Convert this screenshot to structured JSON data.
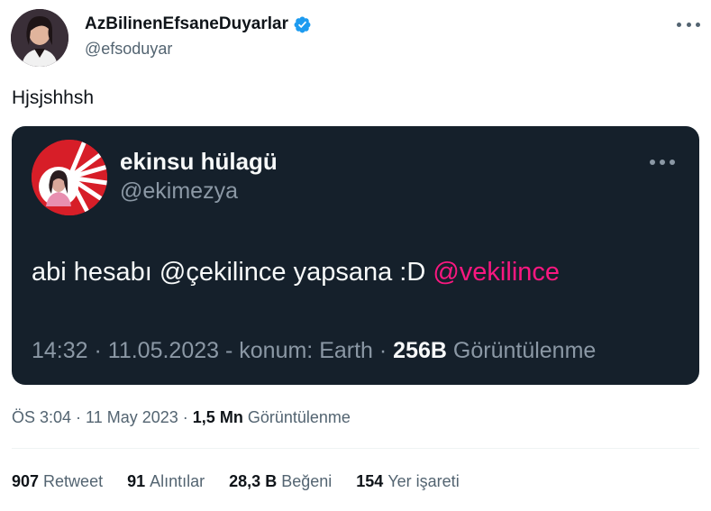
{
  "author": {
    "display_name": "AzBilinenEfsaneDuyarlar",
    "handle": "@efsoduyar",
    "verified_icon": "verified-badge-icon"
  },
  "tweet": {
    "text": "Hjsjshhsh"
  },
  "quoted": {
    "display_name": "ekinsu hülagü",
    "handle": "@ekimezya",
    "text_prefix": "abi hesabı @çekilince yapsana :D",
    "text_mention": "@vekilince",
    "meta_time": "14:32 · 11.05.2023 - konum: Earth ·",
    "meta_views_count": "256B",
    "meta_views_label": "Görüntülenme"
  },
  "meta": {
    "time_date": "ÖS 3:04 · 11 May 2023 ·",
    "views_count": "1,5 Mn",
    "views_label": "Görüntülenme"
  },
  "stats": [
    {
      "count": "907",
      "label": "Retweet"
    },
    {
      "count": "91",
      "label": "Alıntılar"
    },
    {
      "count": "28,3 B",
      "label": "Beğeni"
    },
    {
      "count": "154",
      "label": "Yer işareti"
    }
  ],
  "colors": {
    "accent_blue": "#1d9bf0",
    "mention_pink": "#f91880",
    "embed_bg": "#15202b"
  }
}
